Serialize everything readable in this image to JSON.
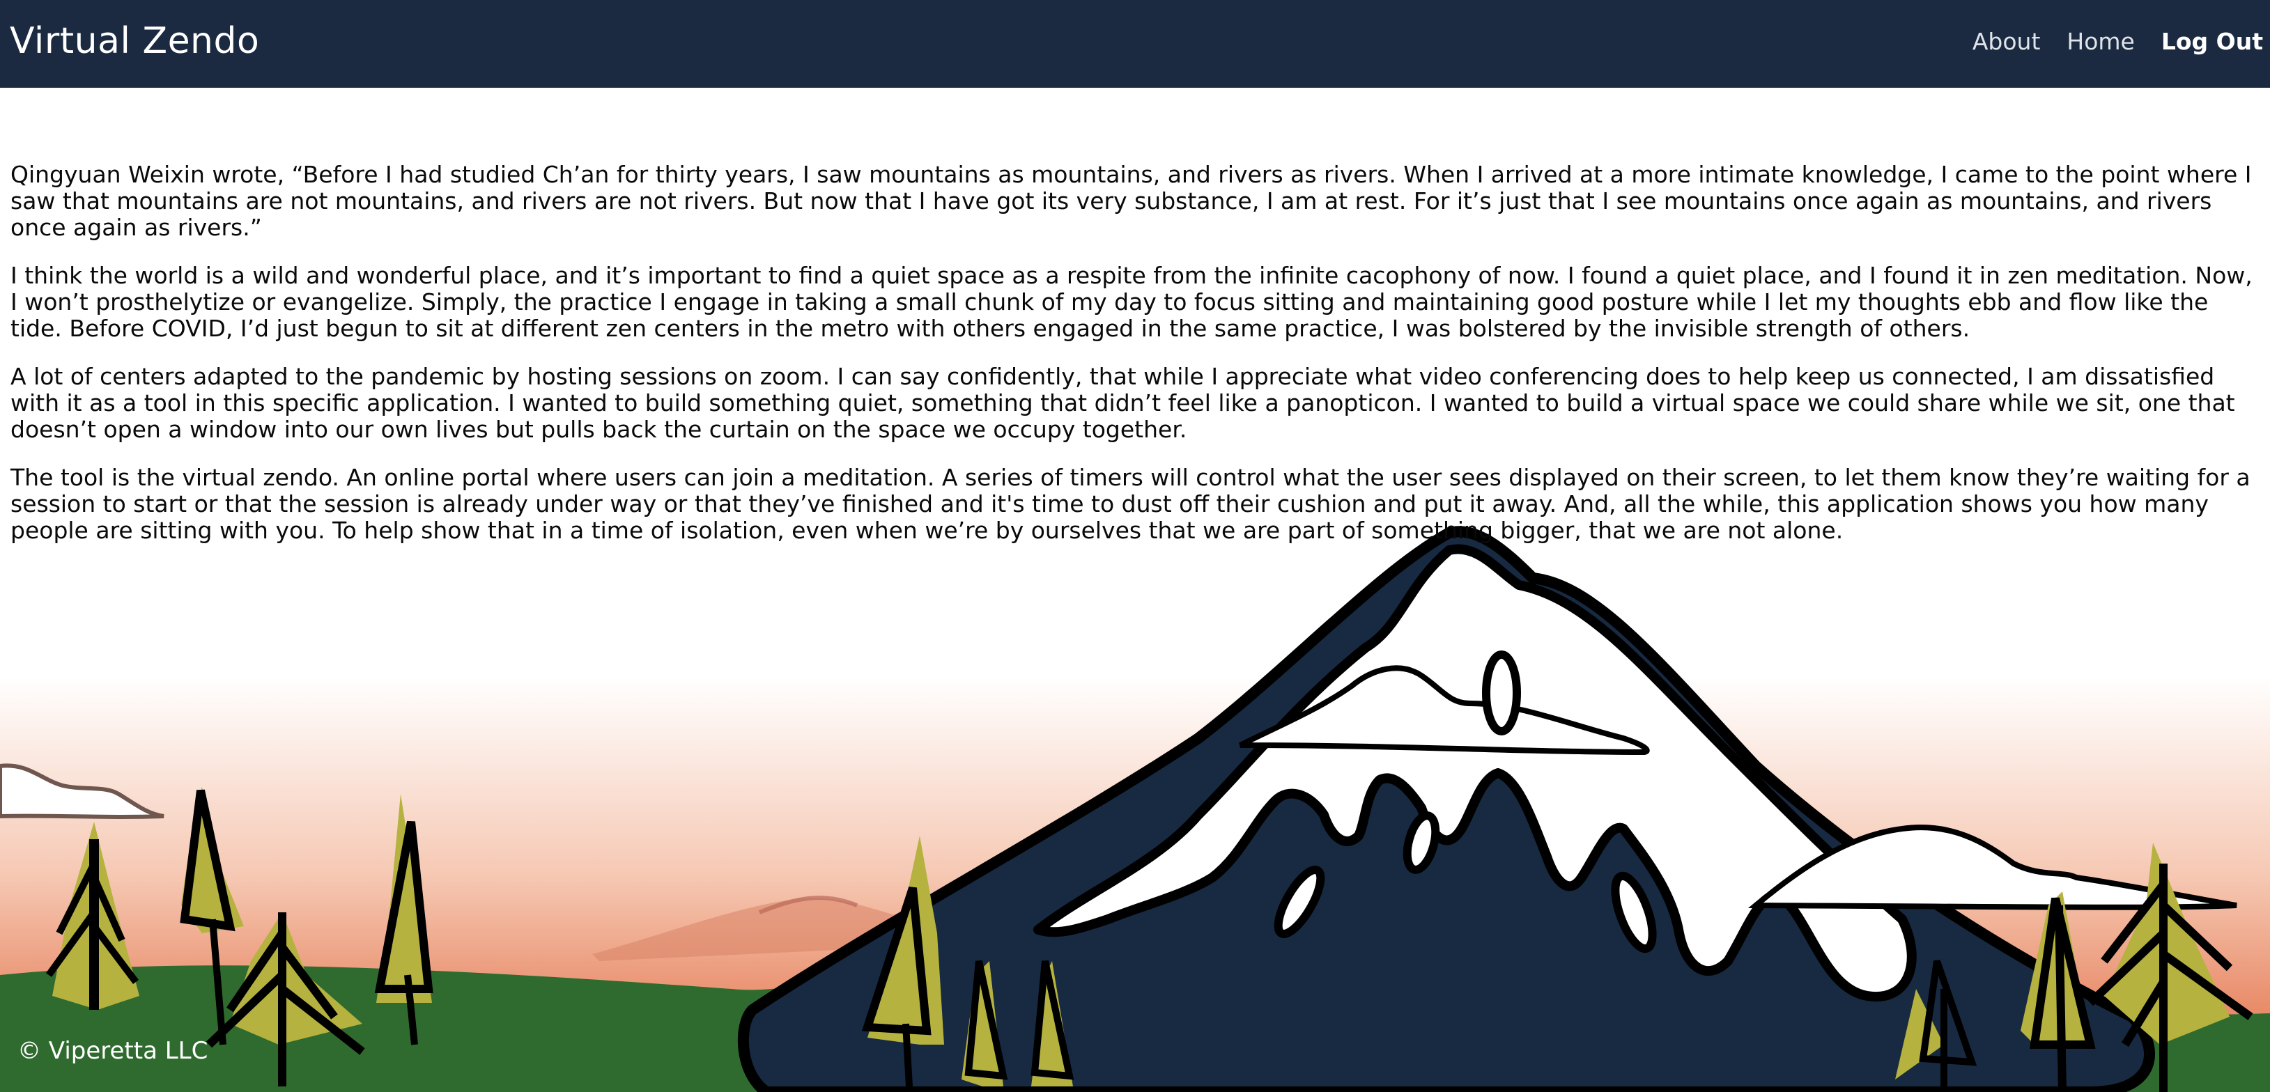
{
  "nav": {
    "brand": "Virtual Zendo",
    "links": [
      "About",
      "Home",
      "Log Out"
    ]
  },
  "content": {
    "paragraphs": [
      "Qingyuan Weixin wrote, “Before I had studied Ch’an for thirty years, I saw mountains as mountains, and rivers as rivers. When I arrived at a more intimate knowledge, I came to the point where I saw that mountains are not mountains, and rivers are not rivers. But now that I have got its very substance, I am at rest. For it’s just that I see mountains once again as mountains, and rivers once again as rivers.”",
      "I think the world is a wild and wonderful place, and it’s important to find a quiet space as a respite from the infinite cacophony of now. I found a quiet place, and I found it in zen meditation. Now, I won’t prosthelytize or evangelize. Simply, the practice I engage in taking a small chunk of my day to focus sitting and maintaining good posture while I let my thoughts ebb and flow like the tide. Before COVID, I’d just begun to sit at different zen centers in the metro with others engaged in the same practice, I was bolstered by the invisible strength of others.",
      "A lot of centers adapted to the pandemic by hosting sessions on zoom. I can say confidently, that while I appreciate what video conferencing does to help keep us connected, I am dissatisfied with it as a tool in this specific application. I wanted to build something quiet, something that didn’t feel like a panopticon. I wanted to build a virtual space we could share while we sit, one that doesn’t open a window into our own lives but pulls back the curtain on the space we occupy together.",
      "The tool is the virtual zendo. An online portal where users can join a meditation. A series of timers will control what the user sees displayed on their screen, to let them know they’re waiting for a session to start or that the session is already under way or that they’ve finished and it's time to dust off their cushion and put it away. And, all the while, this application shows you how many people are sitting with you. To help show that in a time of isolation, even when we’re by ourselves that we are part of something bigger, that we are not alone."
    ]
  },
  "footer": {
    "copyright": "© Viperetta LLC"
  },
  "colors": {
    "navbar": "#1b2a40",
    "sky_glow": "#e57a5c",
    "grass": "#2f6b2f",
    "mountain": "#172a42",
    "tree": "#b5b23f"
  }
}
